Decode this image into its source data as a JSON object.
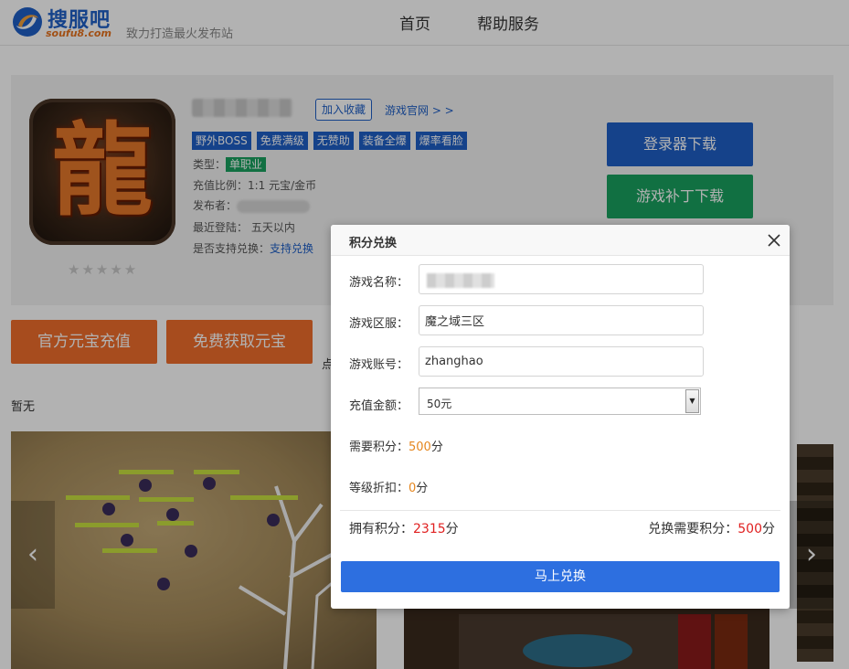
{
  "header": {
    "logo_text": "搜服吧",
    "logo_sub": "soufu8.com",
    "slogan": "致力打造最火发布站",
    "nav": [
      {
        "label": "首页"
      },
      {
        "label": "帮助服务"
      }
    ]
  },
  "game": {
    "icon_glyph": "龍",
    "stars": "★★★★★",
    "favorite_label": "加入收藏",
    "official_link": "游戏官网 > >",
    "tags": [
      "野外BOSS",
      "免费满级",
      "无赞助",
      "装备全爆",
      "爆率看脸"
    ],
    "type_label": "类型：",
    "type_value": "单职业",
    "ratio": "充值比例：1:1 元宝/金币",
    "publisher_label": "发布者：",
    "last_login": "最近登陆： 五天以内",
    "exchange_support_label": "是否支持兑换：",
    "exchange_support_value": "支持兑换",
    "download_launcher": "登录器下载",
    "download_patch": "游戏补丁下载"
  },
  "actions": {
    "official_recharge": "官方元宝充值",
    "free_ingot": "免费获取元宝",
    "side_text": "点"
  },
  "section": {
    "empty_text": "暂无"
  },
  "gallery": {
    "prev": "‹",
    "next": "›"
  },
  "dialog": {
    "title": "积分兑换",
    "fields": {
      "game_name_label": "游戏名称：",
      "server_label": "游戏区服：",
      "server_value": "魔之域三区",
      "account_label": "游戏账号：",
      "account_value": "zhanghao",
      "amount_label": "充值金额：",
      "amount_value": "50元",
      "need_points_label": "需要积分：",
      "need_points_value": "500",
      "need_points_unit": "分",
      "discount_label": "等级折扣：",
      "discount_value": "0",
      "discount_unit": "分"
    },
    "own_points_label": "拥有积分：",
    "own_points_value": "2315",
    "own_points_unit": "分",
    "exchange_need_label": "兑换需要积分：",
    "exchange_need_value": "500",
    "exchange_need_unit": "分",
    "submit_label": "马上兑换"
  },
  "colors": {
    "brand_blue": "#1f5fc6",
    "green": "#19a15f",
    "orange": "#f06e2c",
    "submit_blue": "#2d6fe0"
  }
}
